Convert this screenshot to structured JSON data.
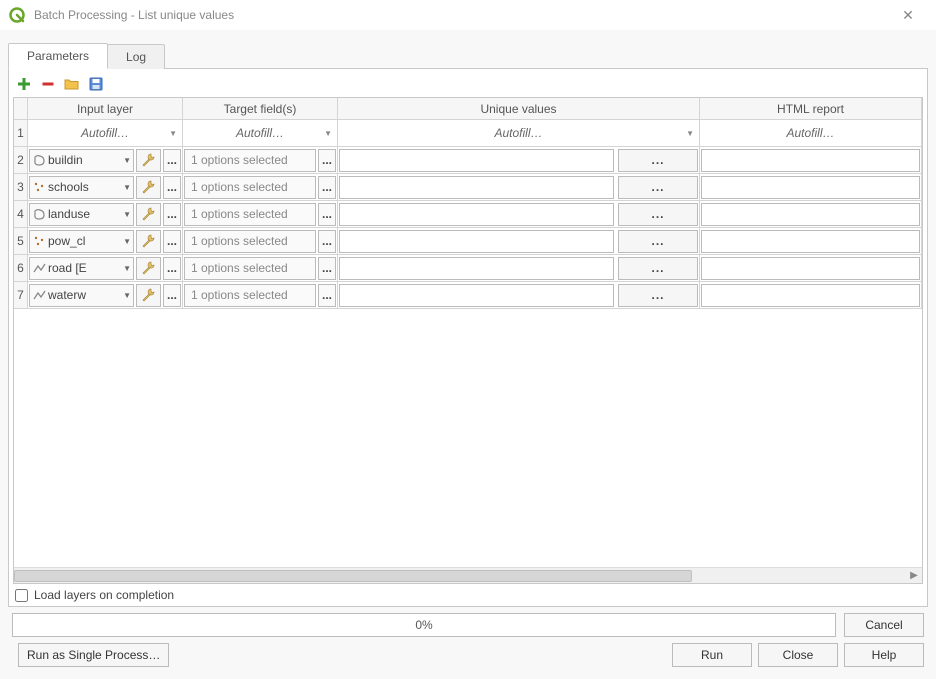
{
  "title": "Batch Processing - List unique values",
  "tabs": {
    "parameters": "Parameters",
    "log": "Log"
  },
  "columns": {
    "input": "Input layer",
    "target": "Target field(s)",
    "unique": "Unique values",
    "html": "HTML report"
  },
  "autofill": "Autofill…",
  "options_selected": "1 options selected",
  "dots": "...",
  "rows": [
    {
      "num": "2",
      "layer": "buildin",
      "layer_icon": "polygon"
    },
    {
      "num": "3",
      "layer": "schools",
      "layer_icon": "point"
    },
    {
      "num": "4",
      "layer": "landuse",
      "layer_icon": "polygon"
    },
    {
      "num": "5",
      "layer": "pow_cl",
      "layer_icon": "point"
    },
    {
      "num": "6",
      "layer": "road [E",
      "layer_icon": "line"
    },
    {
      "num": "7",
      "layer": "waterw",
      "layer_icon": "line"
    }
  ],
  "load_on_completion": "Load layers on completion",
  "progress_text": "0%",
  "buttons": {
    "cancel": "Cancel",
    "run_single": "Run as Single Process…",
    "run": "Run",
    "close": "Close",
    "help": "Help"
  }
}
